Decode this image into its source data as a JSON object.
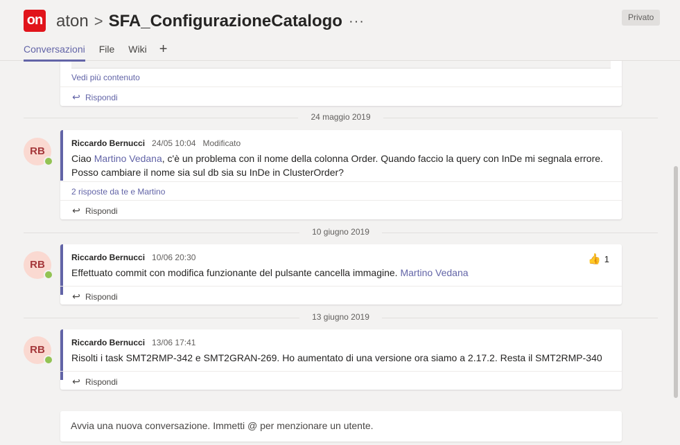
{
  "header": {
    "team_name": "aton",
    "separator": ">",
    "channel_name": "SFA_ConfigurazioneCatalogo",
    "more": "···",
    "privacy_badge": "Privato",
    "logo_text": "on"
  },
  "tabs": [
    {
      "label": "Conversazioni",
      "active": true
    },
    {
      "label": "File",
      "active": false
    },
    {
      "label": "Wiki",
      "active": false
    },
    {
      "label": "+",
      "active": false
    }
  ],
  "top_card": {
    "see_more": "Vedi più contenuto",
    "reply_label": "Rispondi"
  },
  "date_separators": [
    "24 maggio 2019",
    "10 giugno 2019",
    "13 giugno 2019"
  ],
  "messages": [
    {
      "avatar": "RB",
      "author": "Riccardo Bernucci",
      "time": "24/05 10:04",
      "edited": "Modificato",
      "body_pre": "Ciao ",
      "mention": "Martino Vedana",
      "body_post": ", c'è un problema con il nome della colonna Order. Quando faccio la query con InDe mi segnala errore. Posso cambiare il nome sia sul db sia su InDe in ClusterOrder?",
      "replies": "2 risposte da te e Martino",
      "reply_label": "Rispondi"
    },
    {
      "avatar": "RB",
      "author": "Riccardo Bernucci",
      "time": "10/06 20:30",
      "body_pre": "Effettuato commit con modifica funzionante del pulsante cancella immagine. ",
      "mention": "Martino Vedana",
      "reaction_count": "1",
      "reply_label": "Rispondi"
    },
    {
      "avatar": "RB",
      "author": "Riccardo Bernucci",
      "time": "13/06 17:41",
      "body_pre": "Risolti i task SMT2RMP-342 e SMT2GRAN-269. Ho aumentato di una versione ora siamo a 2.17.2. Resta il SMT2RMP-340",
      "reply_label": "Rispondi"
    }
  ],
  "compose": {
    "placeholder": "Avvia una nuova conversazione. Immetti @ per menzionare un utente."
  },
  "colors": {
    "accent": "#6264a7",
    "avatar_bg": "#fad9d1",
    "avatar_text": "#a4373a",
    "presence": "#92c353",
    "logo": "#e1141b"
  },
  "icons": {
    "reply": "reply-arrow-icon",
    "like": "thumbs-up-icon",
    "presence": "presence-available-icon"
  }
}
